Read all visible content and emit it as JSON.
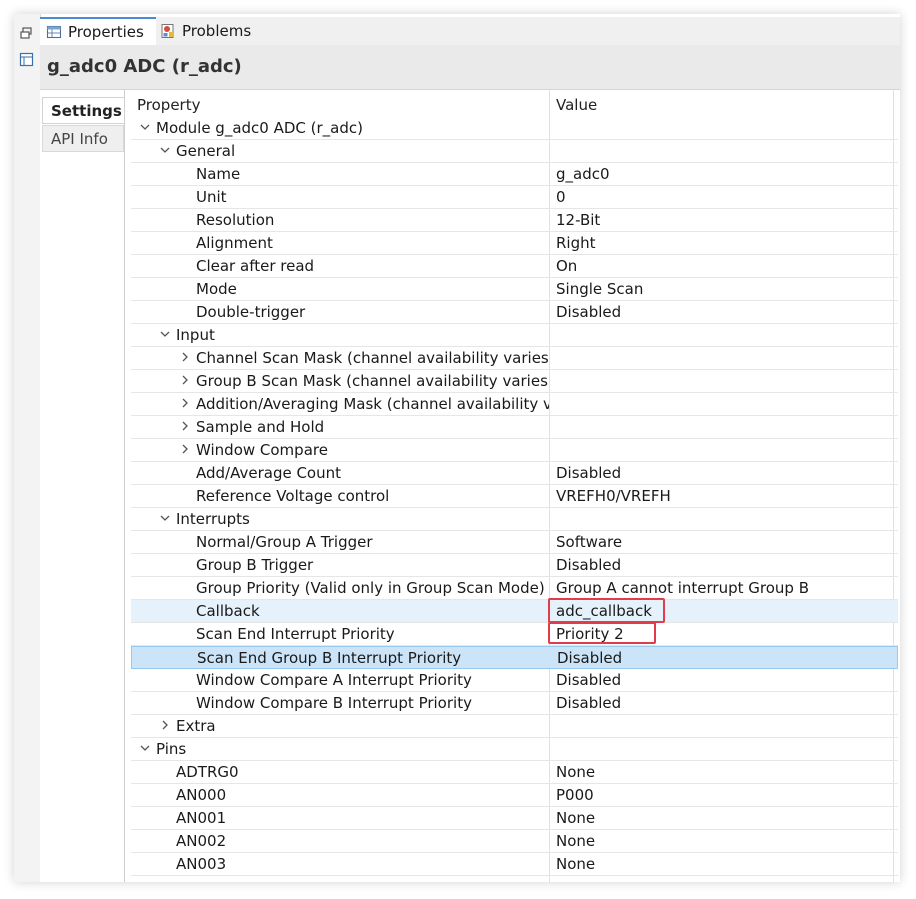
{
  "tabs": [
    {
      "label": "Properties",
      "icon": "properties-icon",
      "active": true
    },
    {
      "label": "Problems",
      "icon": "problems-icon",
      "active": false
    }
  ],
  "title": "g_adc0 ADC (r_adc)",
  "side_tabs": [
    {
      "label": "Settings",
      "active": true
    },
    {
      "label": "API Info",
      "active": false
    }
  ],
  "columns": {
    "property": "Property",
    "value": "Value"
  },
  "rows": [
    {
      "label": "Module g_adc0 ADC (r_adc)",
      "value": "",
      "level": 0,
      "toggle": "expanded"
    },
    {
      "label": "General",
      "value": "",
      "level": 1,
      "toggle": "expanded"
    },
    {
      "label": "Name",
      "value": "g_adc0",
      "level": 2,
      "toggle": "none"
    },
    {
      "label": "Unit",
      "value": "0",
      "level": 2,
      "toggle": "none"
    },
    {
      "label": "Resolution",
      "value": "12-Bit",
      "level": 2,
      "toggle": "none"
    },
    {
      "label": "Alignment",
      "value": "Right",
      "level": 2,
      "toggle": "none"
    },
    {
      "label": "Clear after read",
      "value": "On",
      "level": 2,
      "toggle": "none"
    },
    {
      "label": "Mode",
      "value": "Single Scan",
      "level": 2,
      "toggle": "none"
    },
    {
      "label": "Double-trigger",
      "value": "Disabled",
      "level": 2,
      "toggle": "none"
    },
    {
      "label": "Input",
      "value": "",
      "level": 1,
      "toggle": "expanded"
    },
    {
      "label": "Channel Scan Mask (channel availability varies by",
      "value": "",
      "level": 2,
      "toggle": "collapsed"
    },
    {
      "label": "Group B Scan Mask (channel availability varies by",
      "value": "",
      "level": 2,
      "toggle": "collapsed"
    },
    {
      "label": "Addition/Averaging Mask (channel availability var",
      "value": "",
      "level": 2,
      "toggle": "collapsed"
    },
    {
      "label": "Sample and Hold",
      "value": "",
      "level": 2,
      "toggle": "collapsed"
    },
    {
      "label": "Window Compare",
      "value": "",
      "level": 2,
      "toggle": "collapsed"
    },
    {
      "label": "Add/Average Count",
      "value": "Disabled",
      "level": 2,
      "toggle": "none"
    },
    {
      "label": "Reference Voltage control",
      "value": "VREFH0/VREFH",
      "level": 2,
      "toggle": "none"
    },
    {
      "label": "Interrupts",
      "value": "",
      "level": 1,
      "toggle": "expanded"
    },
    {
      "label": "Normal/Group A Trigger",
      "value": "Software",
      "level": 2,
      "toggle": "none"
    },
    {
      "label": "Group B Trigger",
      "value": "Disabled",
      "level": 2,
      "toggle": "none"
    },
    {
      "label": "Group Priority (Valid only in Group Scan Mode)",
      "value": "Group A cannot interrupt Group B",
      "level": 2,
      "toggle": "none"
    },
    {
      "label": "Callback",
      "value": "adc_callback",
      "level": 2,
      "toggle": "none",
      "state": "hover"
    },
    {
      "label": "Scan End Interrupt Priority",
      "value": "Priority 2",
      "level": 2,
      "toggle": "none"
    },
    {
      "label": "Scan End Group B Interrupt Priority",
      "value": "Disabled",
      "level": 2,
      "toggle": "none",
      "state": "selected"
    },
    {
      "label": "Window Compare A Interrupt Priority",
      "value": "Disabled",
      "level": 2,
      "toggle": "none"
    },
    {
      "label": "Window Compare B Interrupt Priority",
      "value": "Disabled",
      "level": 2,
      "toggle": "none"
    },
    {
      "label": "Extra",
      "value": "",
      "level": 1,
      "toggle": "collapsed"
    },
    {
      "label": "Pins",
      "value": "",
      "level": 0,
      "toggle": "expanded"
    },
    {
      "label": "ADTRG0",
      "value": "None",
      "level": 1,
      "toggle": "none"
    },
    {
      "label": "AN000",
      "value": "P000",
      "level": 1,
      "toggle": "none"
    },
    {
      "label": "AN001",
      "value": "None",
      "level": 1,
      "toggle": "none"
    },
    {
      "label": "AN002",
      "value": "None",
      "level": 1,
      "toggle": "none"
    },
    {
      "label": "AN003",
      "value": "None",
      "level": 1,
      "toggle": "none"
    }
  ],
  "highlight_color": "#e23b4a",
  "selection_color": "#cce4f7"
}
